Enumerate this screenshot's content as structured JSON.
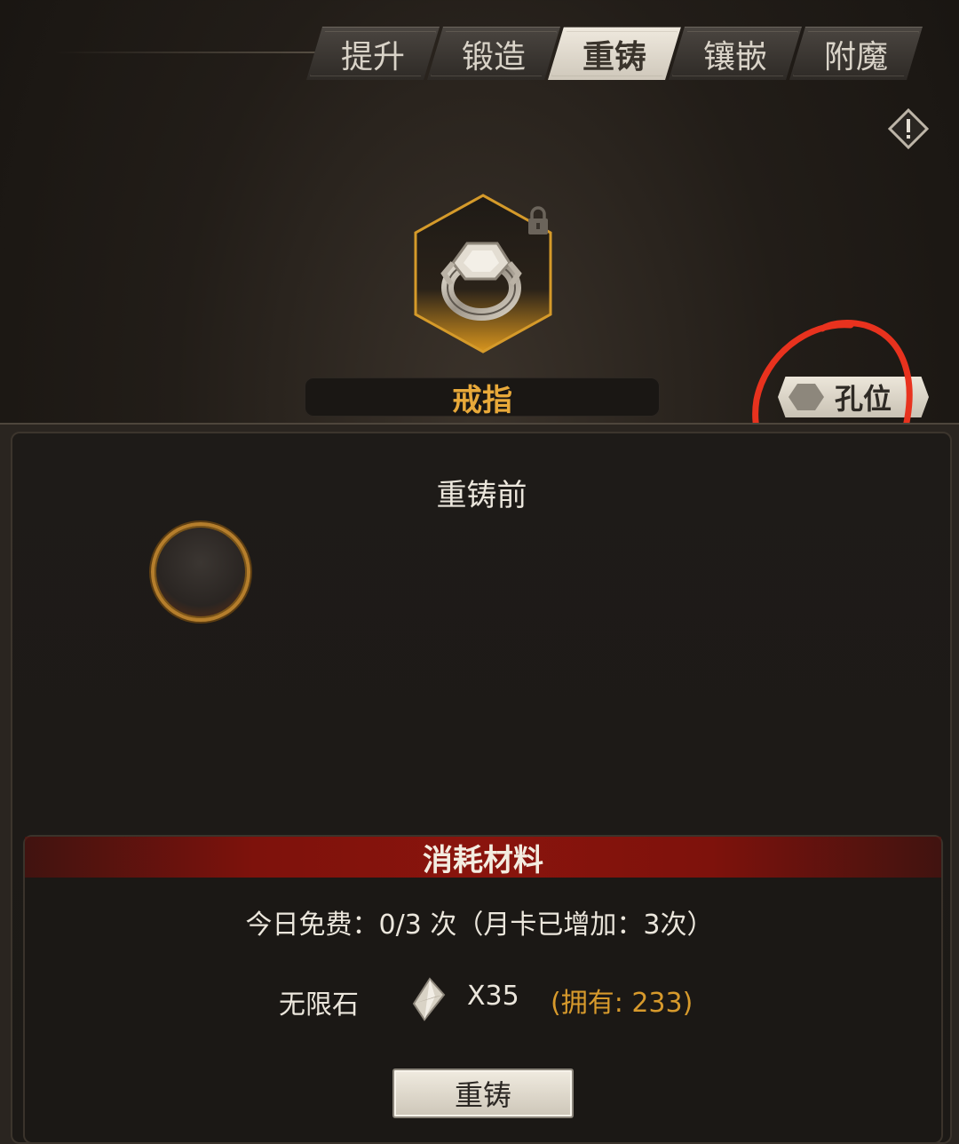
{
  "tabs": [
    {
      "label": "提升",
      "active": false
    },
    {
      "label": "锻造",
      "active": false
    },
    {
      "label": "重铸",
      "active": true
    },
    {
      "label": "镶嵌",
      "active": false
    },
    {
      "label": "附魔",
      "active": false
    }
  ],
  "item": {
    "name": "戒指",
    "icon": "ring-icon",
    "locked": true
  },
  "socket_button_label": "孔位",
  "before": {
    "title": "重铸前"
  },
  "materials": {
    "header": "消耗材料",
    "free_text": "今日免费：0/3 次（月卡已增加：3次）",
    "stone_name": "无限石",
    "stone_icon": "crystal-icon",
    "stone_qty": "X35",
    "stone_owned": "(拥有: 233)"
  },
  "action_button_label": "重铸",
  "colors": {
    "accent_gold": "#e8a93a",
    "header_red": "#8a140d",
    "annotation_red": "#e8321e"
  }
}
